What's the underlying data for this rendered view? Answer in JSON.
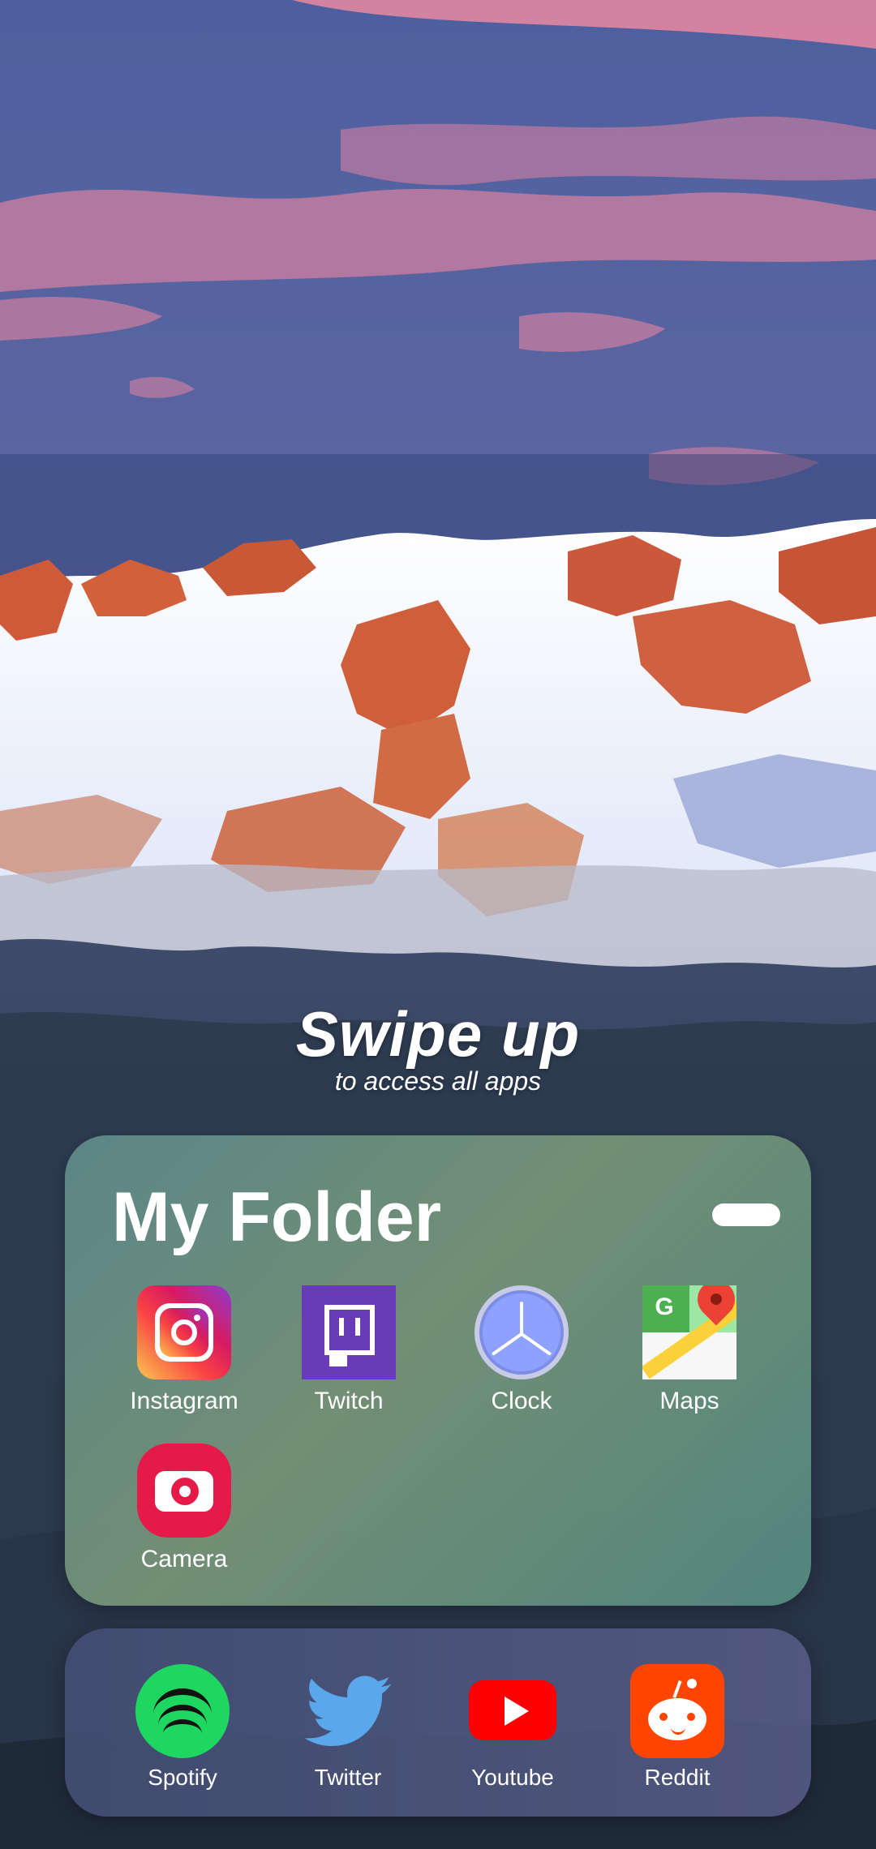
{
  "wallpaper": {
    "sky_top": "#4a5d9c",
    "sky_mid": "#6f6fa5",
    "cloud_pink": "#ff8aa0",
    "snow": "#ffffff",
    "rock_orange": "#d65f3a"
  },
  "swipe_hint": {
    "title": "Swipe up",
    "subtitle": "to access all apps"
  },
  "folder": {
    "title": "My Folder",
    "apps": [
      {
        "label": "Instagram",
        "icon": "instagram-icon"
      },
      {
        "label": "Twitch",
        "icon": "twitch-icon"
      },
      {
        "label": "Clock",
        "icon": "clock-icon"
      },
      {
        "label": "Maps",
        "icon": "maps-icon"
      },
      {
        "label": "Camera",
        "icon": "camera-icon"
      }
    ]
  },
  "dock": {
    "apps": [
      {
        "label": "Spotify",
        "icon": "spotify-icon"
      },
      {
        "label": "Twitter",
        "icon": "twitter-icon"
      },
      {
        "label": "Youtube",
        "icon": "youtube-icon"
      },
      {
        "label": "Reddit",
        "icon": "reddit-icon"
      }
    ]
  }
}
